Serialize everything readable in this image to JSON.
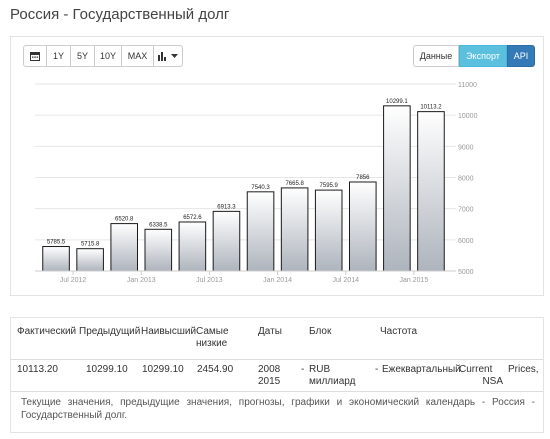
{
  "page": {
    "title": "Россия - Государственный долг"
  },
  "toolbar": {
    "calendar_icon": "calendar-icon",
    "range_buttons": [
      "1Y",
      "5Y",
      "10Y",
      "MAX"
    ],
    "chart_type_icon": "bar-chart-icon",
    "dropdown_icon": "caret-down-icon"
  },
  "actions": {
    "data_label": "Данные",
    "export_label": "Экспорт",
    "api_label": "API"
  },
  "colors": {
    "export_bg": "#5bc0de",
    "api_bg": "#337ab7",
    "bar_top": "#ffffff",
    "bar_bottom": "#aeb4bd",
    "bar_stroke": "#1a1a1a"
  },
  "chart_data": {
    "type": "bar",
    "categories": [
      "Q2 2012",
      "Q3 2012",
      "Q4 2012",
      "Q1 2013",
      "Q2 2013",
      "Q3 2013",
      "Q4 2013",
      "Q1 2014",
      "Q2 2014",
      "Q3 2014",
      "Q4 2014",
      "Q1 2015"
    ],
    "values": [
      5785.5,
      5715.8,
      6520.8,
      6338.5,
      6572.6,
      6913.3,
      7540.3,
      7665.8,
      7595.9,
      7856,
      10299.1,
      10113.2
    ],
    "value_labels": [
      "5785.5",
      "5715.8",
      "6520.8",
      "6338.5",
      "6572.6",
      "6913.3",
      "7540.3",
      "7665.8",
      "7595.9",
      "7856",
      "10299.1",
      "10113.2"
    ],
    "x_tick_labels": [
      "Jul 2012",
      "Jan 2013",
      "Jul 2013",
      "Jan 2014",
      "Jul 2014",
      "Jan 2015"
    ],
    "y_ticks": [
      5000,
      6000,
      7000,
      8000,
      9000,
      10000,
      11000
    ],
    "ylim": [
      5000,
      11000
    ],
    "grid": true,
    "y_axis_side": "right"
  },
  "table": {
    "headers": [
      "Фактический",
      "Предыдущий",
      "Наивысший",
      "Самые",
      "низкие",
      "Даты",
      "Блок",
      "Частота"
    ],
    "row": {
      "actual": "10113.20",
      "previous": "10299.10",
      "highest": "10299.10",
      "lowest": "2454.90",
      "date_from": "2008",
      "date_to": "2015",
      "unit_dash": "-",
      "unit_1": "RUB",
      "unit_2": "миллиард",
      "freq_dash": "-",
      "frequency": "Ежеквартальный",
      "current": "Current",
      "prices": "Prices,",
      "nsa": "NSA"
    },
    "description": "Текущие значения, предыдущие значения, прогнозы, графики и экономический календарь - Россия - Государственный долг."
  }
}
